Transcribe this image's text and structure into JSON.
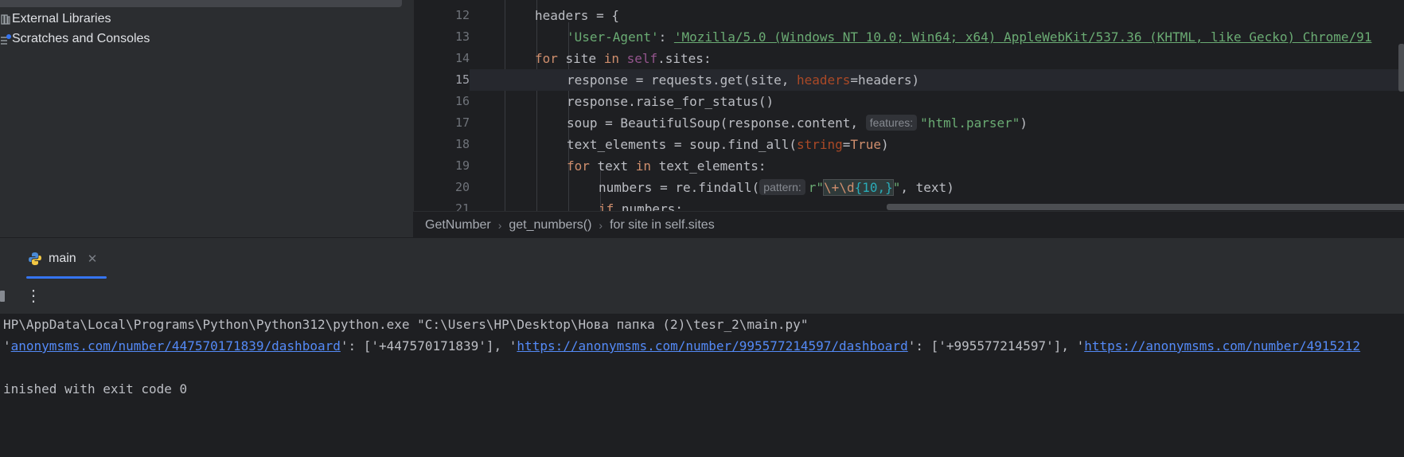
{
  "project_tree": {
    "items": [
      {
        "label": "External Libraries",
        "icon": "library-icon"
      },
      {
        "label": "Scratches and Consoles",
        "icon": "scratches-icon"
      }
    ]
  },
  "editor": {
    "line_numbers": [
      "12",
      "13",
      "14",
      "15",
      "16",
      "17",
      "18",
      "19",
      "20",
      "21"
    ],
    "current_line": "15",
    "code": {
      "l12": {
        "a": "headers = {"
      },
      "l13": {
        "key": "'User-Agent'",
        "colon": ": ",
        "val": "'Mozilla/5.0 (Windows NT 10.0; Win64; x64) AppleWebKit/537.36 (KHTML, like Gecko) Chrome/91"
      },
      "l14": {
        "kw1": "for",
        "t1": " site ",
        "kw2": "in",
        "t2": " ",
        "self": "self",
        "t3": ".sites:"
      },
      "l15": {
        "t1": "response = requests.get(site, ",
        "param": "headers",
        "t2": "=headers)"
      },
      "l16": {
        "t1": "response.raise_for_status()"
      },
      "l17": {
        "t1": "soup = BeautifulSoup(response.content, ",
        "hint": "features:",
        "str": "\"html.parser\"",
        "t2": ")"
      },
      "l18": {
        "t1": "text_elements = soup.find_all(",
        "param": "string",
        "eq": "=",
        "kw": "True",
        "t2": ")"
      },
      "l19": {
        "kw1": "for",
        "t1": " text ",
        "kw2": "in",
        "t2": " text_elements:"
      },
      "l20": {
        "t1": "numbers = re.findall(",
        "hint": "pattern:",
        "pre": "r\"",
        "rx1": "\\+\\d",
        "rx2": "{10,}",
        "post": "\"",
        "t2": ", text)"
      },
      "l21": {
        "kw": "if",
        "t1": " numbers:"
      }
    }
  },
  "breadcrumb": [
    "GetNumber",
    "get_numbers()",
    "for site in self.sites"
  ],
  "run_panel": {
    "tab_label": "main",
    "console": {
      "cmd": "HP\\AppData\\Local\\Programs\\Python\\Python312\\python.exe \"C:\\Users\\HP\\Desktop\\Нова папка (2)\\tesr_2\\main.py\"",
      "out": {
        "p0": "'",
        "link1": "anonymsms.com/number/447570171839/dashboard",
        "mid1": "': ['+447570171839'], '",
        "link2": "https://anonymsms.com/number/995577214597/dashboard",
        "mid2": "': ['+995577214597'], '",
        "link3": "https://anonymsms.com/number/4915212"
      },
      "exit": "inished with exit code 0"
    }
  },
  "colors": {
    "accent": "#3574f0",
    "keyword": "#cf8e6d",
    "string": "#6aab73",
    "link": "#548af7"
  }
}
